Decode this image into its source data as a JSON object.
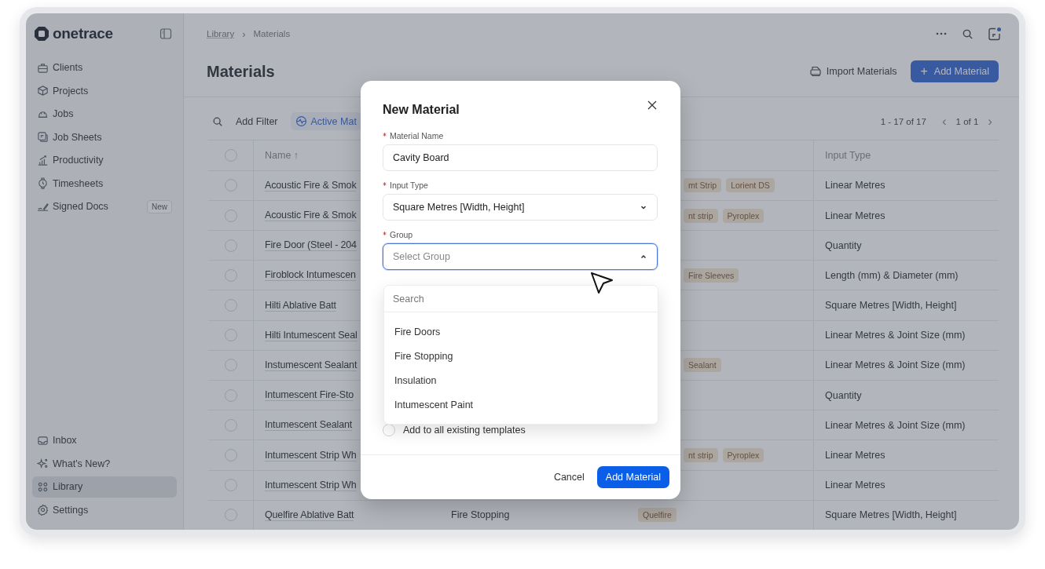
{
  "sidebar": {
    "logo": "onetrace",
    "items": [
      {
        "label": "Clients",
        "selected": false
      },
      {
        "label": "Projects",
        "selected": false
      },
      {
        "label": "Jobs",
        "selected": false
      },
      {
        "label": "Job Sheets",
        "selected": false
      },
      {
        "label": "Productivity",
        "selected": false
      },
      {
        "label": "Timesheets",
        "selected": false
      },
      {
        "label": "Signed Docs",
        "selected": false,
        "badge": "New"
      }
    ],
    "bottom_items": [
      {
        "label": "Inbox",
        "selected": false
      },
      {
        "label": "What's New?",
        "selected": false
      },
      {
        "label": "Library",
        "selected": true
      },
      {
        "label": "Settings",
        "selected": false
      }
    ]
  },
  "breadcrumb": [
    "Library",
    "›",
    "Materials"
  ],
  "page_title": "Materials",
  "header_actions": {
    "import": "Import Materials",
    "add_symbol": "+",
    "add": "Add Material"
  },
  "toolbar": {
    "add_filter": "Add Filter",
    "active_filter": "Active Mat",
    "range": "1 - 17 of 17",
    "previous": "‹",
    "page": "1 of 1",
    "next": "›"
  },
  "table": {
    "all_selected": false,
    "name_heading": "Name ↑",
    "input_type_heading": "Input Type",
    "rows": [
      {
        "selected": false,
        "name": "Acoustic Fire & Smok",
        "tags": [
          "mt Strip",
          "Lorient DS"
        ],
        "input_type": "Linear Metres"
      },
      {
        "selected": false,
        "name": "Acoustic Fire & Smok",
        "tags": [
          "nt strip",
          "Pyroplex"
        ],
        "input_type": "Linear Metres"
      },
      {
        "selected": false,
        "name": "Fire Door (Steel - 204",
        "tags": [],
        "input_type": "Quantity"
      },
      {
        "selected": false,
        "name": "Firoblock Intumescen",
        "tags": [
          "Fire Sleeves"
        ],
        "input_type": "Length (mm) & Diameter (mm)"
      },
      {
        "selected": false,
        "name": "Hilti Ablative Batt",
        "tags": [],
        "input_type": "Square Metres [Width, Height]"
      },
      {
        "selected": false,
        "name": "Hilti Intumescent Seal",
        "tags": [],
        "input_type": "Linear Metres & Joint Size (mm)"
      },
      {
        "selected": false,
        "name": "Instumescent Sealant",
        "tags": [
          "Sealant"
        ],
        "input_type": "Linear Metres & Joint Size (mm)"
      },
      {
        "selected": false,
        "name": "Intumescent Fire-Sto",
        "tags": [],
        "input_type": "Quantity"
      },
      {
        "selected": false,
        "name": "Intumescent Sealant",
        "tags": [],
        "input_type": "Linear Metres & Joint Size (mm)"
      },
      {
        "selected": false,
        "name": "Intumescent Strip Wh",
        "tags": [
          "nt strip",
          "Pyroplex"
        ],
        "input_type": "Linear Metres"
      },
      {
        "selected": false,
        "name": "Intumescent Strip Wh",
        "tags": [],
        "input_type": "Linear Metres"
      },
      {
        "selected": false,
        "name": "Quelfire Ablative Batt",
        "group": "Fire Stopping",
        "tags": [
          "Quelfire"
        ],
        "input_type": "Square Metres [Width, Height]"
      }
    ]
  },
  "modal": {
    "title": "New Material",
    "fields": [
      {
        "kind": "text",
        "label": "Material Name",
        "required": true,
        "value": "Cavity Board"
      },
      {
        "kind": "select",
        "label": "Input Type",
        "required": true,
        "value": "Square Metres [Width, Height]",
        "expanded": false
      },
      {
        "kind": "select",
        "label": "Group",
        "required": true,
        "placeholder": "Select Group",
        "expanded": true
      }
    ],
    "checkbox": {
      "label": "Add to all existing templates",
      "checked": false
    },
    "cancel": "Cancel",
    "submit": "Add Material"
  },
  "dropdown": {
    "search_placeholder": "Search",
    "options": [
      "Fire Doors",
      "Fire Stopping",
      "Insulation",
      "Intumescent Paint"
    ]
  }
}
